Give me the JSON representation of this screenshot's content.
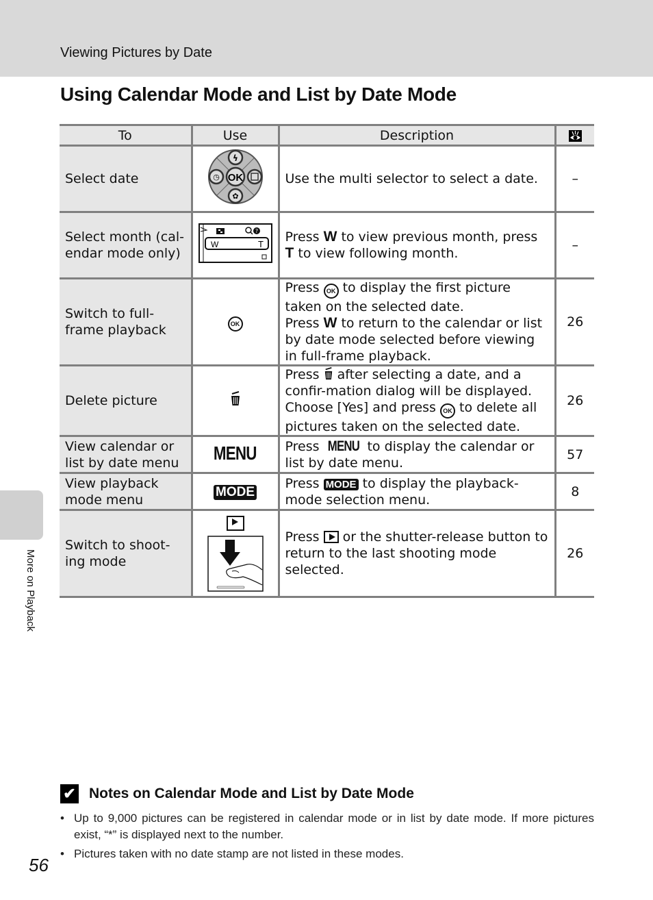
{
  "header": {
    "section_label": "Viewing Pictures by Date",
    "title": "Using Calendar Mode and List by Date Mode"
  },
  "side_tab": {
    "label": "More on Playback"
  },
  "table": {
    "columns": [
      "To",
      "Use",
      "Description",
      "reference-icon"
    ],
    "rows": [
      {
        "to": "Select date",
        "use_icon": "multi-selector-icon",
        "desc": [
          "Use the multi selector to select a date."
        ],
        "ref": "–"
      },
      {
        "to": "Select month (cal-endar mode only)",
        "use_icon": "zoom-control-icon",
        "desc_parts": [
          "Press",
          "W",
          "to view previous month, press",
          "T",
          "to view following month."
        ],
        "ref": "–"
      },
      {
        "to": "Switch to full-frame playback",
        "use_icon": "ok-button-icon",
        "desc_parts": [
          "Press",
          "OK",
          "to display the first picture taken on the selected date.",
          "Press",
          "W",
          "to return to the calendar or list by date mode selected before viewing in full-frame playback."
        ],
        "ref": "26"
      },
      {
        "to": "Delete picture",
        "use_icon": "trash-icon",
        "desc_parts": [
          "Press",
          "after selecting a date, and a confir-mation dialog will be displayed. Choose [Yes] and press",
          "OK",
          "to delete all pictures taken on the selected date."
        ],
        "ref": "26"
      },
      {
        "to": "View calendar or list by date menu",
        "use_icon": "menu-button-icon",
        "use_text": "MENU",
        "desc_parts": [
          "Press",
          "MENU",
          "to display the calendar or list by date menu."
        ],
        "ref": "57"
      },
      {
        "to": "View playback mode menu",
        "use_icon": "mode-button-icon",
        "use_text": "MODE",
        "desc_parts": [
          "Press",
          "MODE",
          "to display the playback-mode selection menu."
        ],
        "ref": "8"
      },
      {
        "to": "Switch to shoot-ing mode",
        "use_icon": "playback-button-icon",
        "desc_parts": [
          "Press",
          "or the shutter-release button to return to the last shooting mode selected."
        ],
        "ref": "26"
      }
    ]
  },
  "notes": {
    "title": "Notes on Calendar Mode and List by Date Mode",
    "items": [
      "Up to 9,000 pictures can be registered in calendar mode or in list by date mode. If more pictures exist, “*” is displayed next to the number.",
      "Pictures taken with no date stamp are not listed in these modes."
    ]
  },
  "page_number": "56"
}
